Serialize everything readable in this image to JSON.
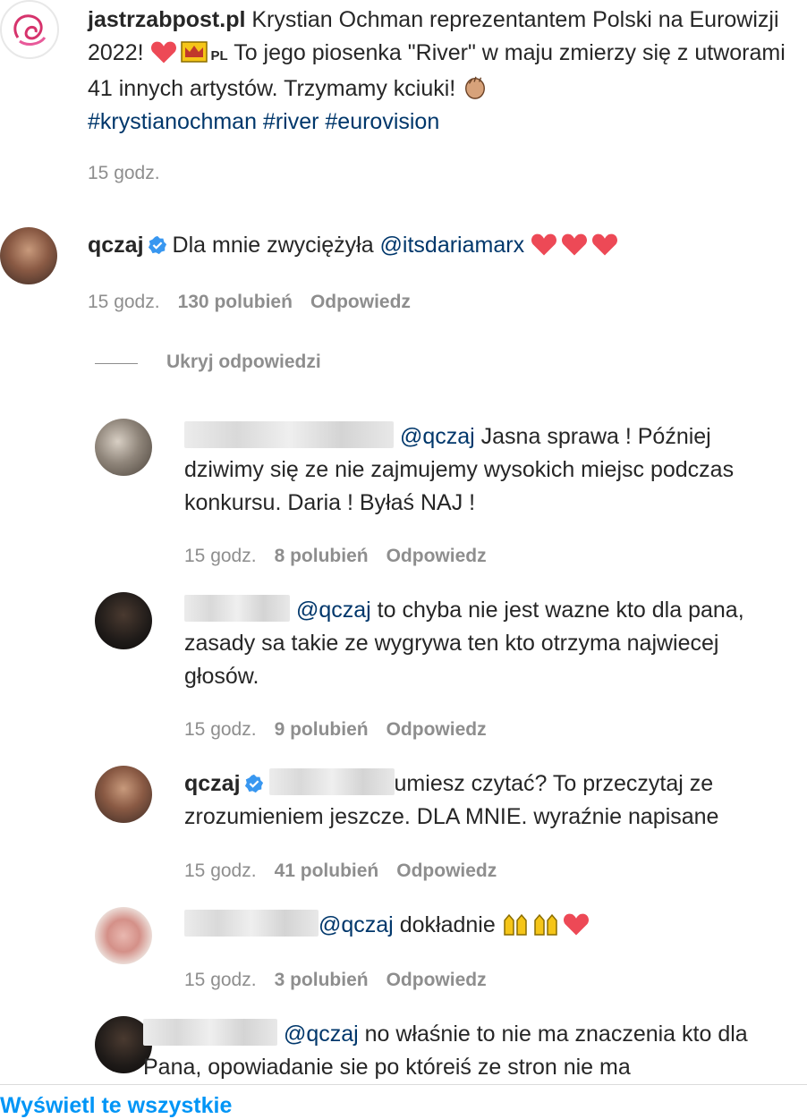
{
  "post": {
    "username": "jastrzabpost.pl",
    "caption_part1": "Krystian Ochman reprezentantem Polski na Eurowizji 2022!",
    "flag_text": "PL",
    "caption_part2": "To jego piosenka \"River\" w maju zmierzy się z utworami 41 innych artystów. Trzymamy kciuki!",
    "hashtags": "#krystianochman #river #eurovision",
    "time": "15 godz."
  },
  "comment1": {
    "username": "qczaj",
    "text_prefix": "Dla mnie zwyciężyła",
    "mention": "@itsdariamarx",
    "time": "15 godz.",
    "likes": "130 polubień",
    "reply": "Odpowiedz"
  },
  "hide_replies": "Ukryj odpowiedzi",
  "reply1": {
    "mention": "@qczaj",
    "text": "Jasna sprawa ! Później dziwimy się ze nie zajmujemy wysokich miejsc podczas konkursu. Daria ! Byłaś NAJ !",
    "time": "15 godz.",
    "likes": "8 polubień",
    "reply": "Odpowiedz"
  },
  "reply2": {
    "mention": "@qczaj",
    "text": "to chyba nie jest wazne kto dla pana, zasady sa takie ze wygrywa ten kto otrzyma najwiecej głosów.",
    "time": "15 godz.",
    "likes": "9 polubień",
    "reply": "Odpowiedz"
  },
  "reply3": {
    "username": "qczaj",
    "text": "umiesz czytać? To przeczytaj ze zrozumieniem jeszcze. DLA MNIE. wyraźnie napisane",
    "time": "15 godz.",
    "likes": "41 polubień",
    "reply": "Odpowiedz"
  },
  "reply4": {
    "mention": "@qczaj",
    "text": "dokładnie",
    "time": "15 godz.",
    "likes": "3 polubień",
    "reply": "Odpowiedz"
  },
  "reply5": {
    "mention": "@qczaj",
    "text": "no właśnie to nie ma znaczenia kto dla Pana, opowiadanie sie po któreiś ze stron nie ma"
  },
  "footer": {
    "link": "Wyświetl te wszystkie"
  },
  "colors": {
    "link": "#00376b",
    "muted": "#8e8e8e",
    "verified": "#3897f0",
    "heart": "#ed4956",
    "accent": "#0095f6"
  }
}
